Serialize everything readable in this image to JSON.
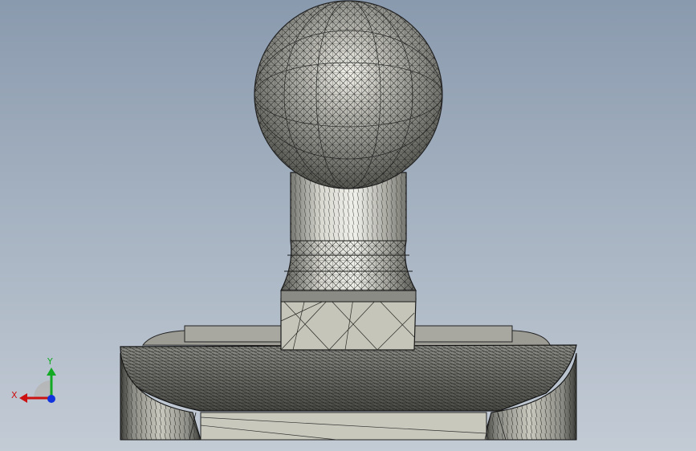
{
  "scene": {
    "model_colors": {
      "shaded_fill": "#9a9a94",
      "highlight": "#f4f4ee",
      "mesh_edge": "#1e1e1e",
      "flat_face": "#c8c8bc"
    },
    "background": {
      "top": "#8a9aae",
      "bottom": "#c3cbd5"
    }
  },
  "triad": {
    "x_label": "X",
    "y_label": "Y",
    "x_color": "#cc1111",
    "y_color": "#11aa22",
    "z_color": "#1133dd"
  }
}
